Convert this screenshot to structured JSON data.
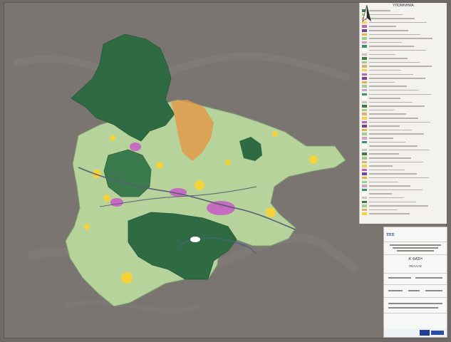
{
  "legend": {
    "header": "ΥΠΟΜΝΗΜΑ",
    "colors": [
      "#3f7a46",
      "#a8c88a",
      "#d8b36b",
      "#f2d34a",
      "#c75fb5",
      "#6a4a8a",
      "#e7b24a",
      "#9dd08f",
      "#d1a0c7",
      "#3d8f6f",
      "#ffffff",
      "#c9c6bf"
    ]
  },
  "north_arrow": {
    "icon": "north-arrow-icon"
  },
  "map": {
    "colors": {
      "forest": "#2f6b42",
      "agri": "#b5d39b",
      "urban": "#f3d23a",
      "industry": "#c46cc0",
      "orange": "#e09a4a",
      "lake": "#ffffff",
      "road": "#5a5c75",
      "river": "#4e5d8c"
    },
    "icons": [
      "settlement-icon",
      "lake-icon",
      "road-icon"
    ]
  },
  "title_block": {
    "logo": "ΤΕΕ",
    "icons": [
      "tee-logo-icon",
      "emblem-icon",
      "eu-flag-icon"
    ],
    "label_a": "Α' ΦΑΣΗ",
    "label_b": "ΠΕΛΛΑΣ"
  }
}
